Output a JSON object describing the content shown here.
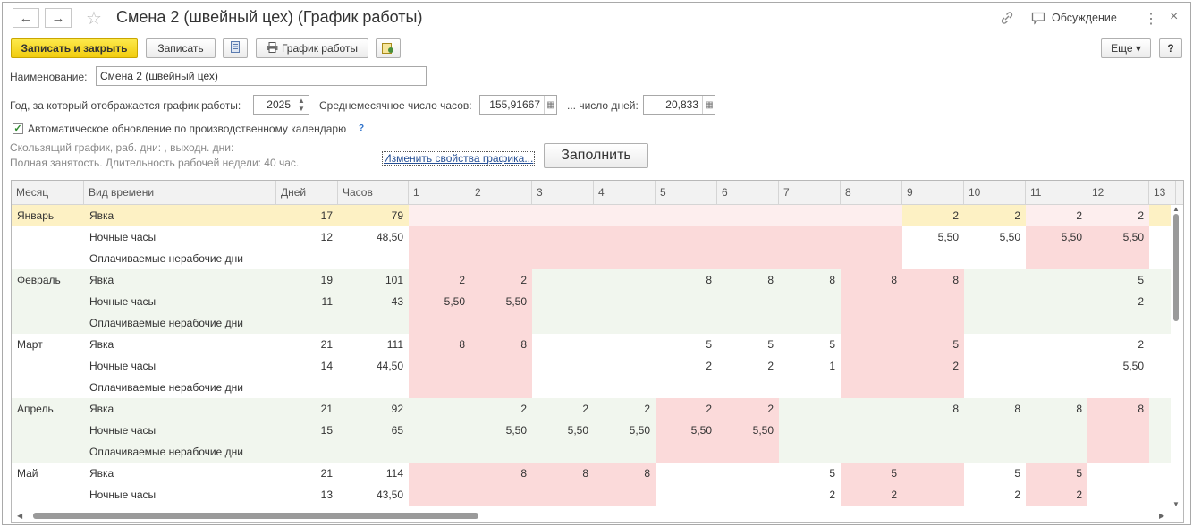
{
  "window": {
    "title": "Смена 2 (швейный цех) (График работы)",
    "back_icon": "←",
    "forward_icon": "→",
    "star_icon": "☆",
    "discussion_label": "Обсуждение",
    "more_icon": "⋮",
    "close_icon": "×"
  },
  "toolbar": {
    "save_close_label": "Записать и закрыть",
    "save_label": "Записать",
    "schedule_label": "График работы",
    "more_label": "Еще ▾",
    "help_label": "?"
  },
  "form": {
    "name_label": "Наименование:",
    "name_value": "Смена 2 (швейный цех)",
    "year_label": "Год, за который отображается график работы:",
    "year_value": "2025",
    "avg_hours_label": "Среднемесячное число часов:",
    "avg_hours_value": "155,91667",
    "days_label": "... число дней:",
    "days_value": "20,833",
    "auto_update_label": "Автоматическое обновление по производственному календарю",
    "auto_update_checked": true,
    "help_mark": "?",
    "info_line1": "Скользящий график, раб. дни: , выходн. дни:",
    "info_line2": "Полная занятость. Длительность рабочей недели: 40 час.",
    "change_link": "Изменить свойства графика...",
    "fill_button": "Заполнить"
  },
  "colors": {
    "selected_row": "#fdf1c4",
    "selected_cell_pale": "#fdeeee",
    "weekend": "#fbdada",
    "alt_band": "#f1f6ee",
    "white": "#ffffff"
  },
  "grid": {
    "headers": [
      "Месяц",
      "Вид времени",
      "Дней",
      "Часов",
      "1",
      "2",
      "3",
      "4",
      "5",
      "6",
      "7",
      "8",
      "9",
      "10",
      "11",
      "12",
      "13"
    ],
    "rows": [
      {
        "month": "Январь",
        "kind": "Явка",
        "days": "17",
        "hours": "79",
        "selected": true,
        "cells": [
          "",
          "",
          "",
          "",
          "",
          "",
          "",
          "",
          "2",
          "2",
          "2",
          "2",
          ""
        ],
        "bg": [
          "p",
          "p",
          "p",
          "p",
          "p",
          "p",
          "p",
          "p",
          "s",
          "s",
          "p",
          "p",
          "s"
        ]
      },
      {
        "month": "",
        "kind": "Ночные часы",
        "days": "12",
        "hours": "48,50",
        "cells": [
          "",
          "",
          "",
          "",
          "",
          "",
          "",
          "",
          "5,50",
          "5,50",
          "5,50",
          "5,50",
          ""
        ],
        "bg": [
          "k",
          "k",
          "k",
          "k",
          "k",
          "k",
          "k",
          "k",
          "w",
          "w",
          "k",
          "k",
          "w"
        ]
      },
      {
        "month": "",
        "kind": "Оплачиваемые нерабочие дни",
        "days": "",
        "hours": "",
        "cells": [
          "",
          "",
          "",
          "",
          "",
          "",
          "",
          "",
          "",
          "",
          "",
          "",
          ""
        ],
        "bg": [
          "k",
          "k",
          "k",
          "k",
          "k",
          "k",
          "k",
          "k",
          "w",
          "w",
          "k",
          "k",
          "w"
        ]
      },
      {
        "month": "Февраль",
        "kind": "Явка",
        "days": "19",
        "hours": "101",
        "cells": [
          "2",
          "2",
          "",
          "",
          "8",
          "8",
          "8",
          "8",
          "8",
          "",
          "",
          "5",
          ""
        ],
        "bg": [
          "k",
          "k",
          "g",
          "g",
          "g",
          "g",
          "g",
          "k",
          "k",
          "g",
          "g",
          "g",
          "g"
        ]
      },
      {
        "month": "",
        "kind": "Ночные часы",
        "days": "11",
        "hours": "43",
        "cells": [
          "5,50",
          "5,50",
          "",
          "",
          "",
          "",
          "",
          "",
          "",
          "",
          "",
          "2",
          ""
        ],
        "bg": [
          "k",
          "k",
          "g",
          "g",
          "g",
          "g",
          "g",
          "k",
          "k",
          "g",
          "g",
          "g",
          "g"
        ]
      },
      {
        "month": "",
        "kind": "Оплачиваемые нерабочие дни",
        "days": "",
        "hours": "",
        "cells": [
          "",
          "",
          "",
          "",
          "",
          "",
          "",
          "",
          "",
          "",
          "",
          "",
          ""
        ],
        "bg": [
          "k",
          "k",
          "g",
          "g",
          "g",
          "g",
          "g",
          "k",
          "k",
          "g",
          "g",
          "g",
          "g"
        ]
      },
      {
        "month": "Март",
        "kind": "Явка",
        "days": "21",
        "hours": "111",
        "cells": [
          "8",
          "8",
          "",
          "",
          "5",
          "5",
          "5",
          "",
          "5",
          "",
          "",
          "2",
          ""
        ],
        "bg": [
          "k",
          "k",
          "w",
          "w",
          "w",
          "w",
          "w",
          "k",
          "k",
          "w",
          "w",
          "w",
          "w"
        ]
      },
      {
        "month": "",
        "kind": "Ночные часы",
        "days": "14",
        "hours": "44,50",
        "cells": [
          "",
          "",
          "",
          "",
          "2",
          "2",
          "1",
          "",
          "2",
          "",
          "",
          "5,50",
          ""
        ],
        "bg": [
          "k",
          "k",
          "w",
          "w",
          "w",
          "w",
          "w",
          "k",
          "k",
          "w",
          "w",
          "w",
          "w"
        ]
      },
      {
        "month": "",
        "kind": "Оплачиваемые нерабочие дни",
        "days": "",
        "hours": "",
        "cells": [
          "",
          "",
          "",
          "",
          "",
          "",
          "",
          "",
          "",
          "",
          "",
          "",
          ""
        ],
        "bg": [
          "k",
          "k",
          "w",
          "w",
          "w",
          "w",
          "w",
          "k",
          "k",
          "w",
          "w",
          "w",
          "w"
        ]
      },
      {
        "month": "Апрель",
        "kind": "Явка",
        "days": "21",
        "hours": "92",
        "cells": [
          "",
          "2",
          "2",
          "2",
          "2",
          "2",
          "",
          "",
          "8",
          "8",
          "8",
          "8",
          ""
        ],
        "bg": [
          "g",
          "g",
          "g",
          "g",
          "k",
          "k",
          "g",
          "g",
          "g",
          "g",
          "g",
          "k",
          "g"
        ]
      },
      {
        "month": "",
        "kind": "Ночные часы",
        "days": "15",
        "hours": "65",
        "cells": [
          "",
          "5,50",
          "5,50",
          "5,50",
          "5,50",
          "5,50",
          "",
          "",
          "",
          "",
          "",
          "",
          ""
        ],
        "bg": [
          "g",
          "g",
          "g",
          "g",
          "k",
          "k",
          "g",
          "g",
          "g",
          "g",
          "g",
          "k",
          "g"
        ]
      },
      {
        "month": "",
        "kind": "Оплачиваемые нерабочие дни",
        "days": "",
        "hours": "",
        "cells": [
          "",
          "",
          "",
          "",
          "",
          "",
          "",
          "",
          "",
          "",
          "",
          "",
          ""
        ],
        "bg": [
          "g",
          "g",
          "g",
          "g",
          "k",
          "k",
          "g",
          "g",
          "g",
          "g",
          "g",
          "k",
          "g"
        ]
      },
      {
        "month": "Май",
        "kind": "Явка",
        "days": "21",
        "hours": "114",
        "cells": [
          "",
          "8",
          "8",
          "8",
          "",
          "",
          "5",
          "5",
          "",
          "5",
          "5",
          "",
          ""
        ],
        "bg": [
          "k",
          "k",
          "k",
          "k",
          "w",
          "w",
          "w",
          "k",
          "k",
          "w",
          "k",
          "w",
          "w"
        ]
      },
      {
        "month": "",
        "kind": "Ночные часы",
        "days": "13",
        "hours": "43,50",
        "cells": [
          "",
          "",
          "",
          "",
          "",
          "",
          "2",
          "2",
          "",
          "2",
          "2",
          "",
          ""
        ],
        "bg": [
          "k",
          "k",
          "k",
          "k",
          "w",
          "w",
          "w",
          "k",
          "k",
          "w",
          "k",
          "w",
          "w"
        ]
      }
    ]
  }
}
